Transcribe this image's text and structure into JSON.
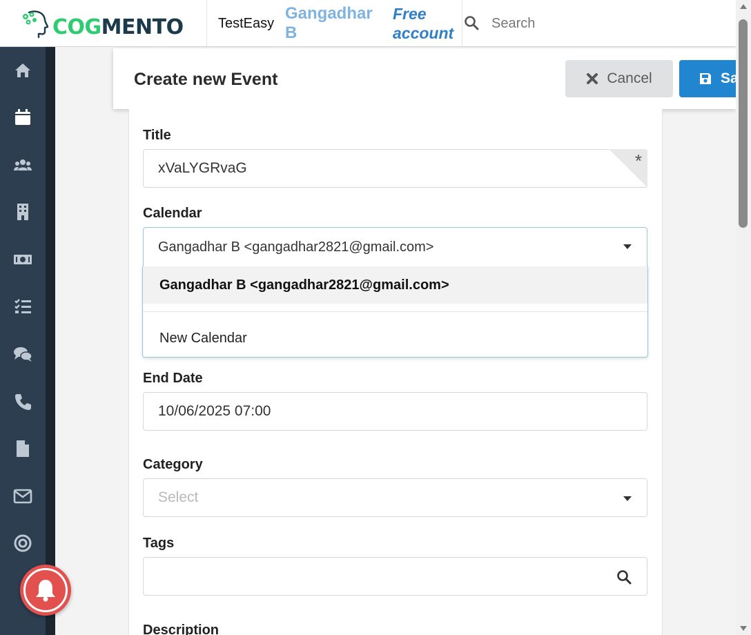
{
  "header": {
    "logo_text_1": "COG",
    "logo_text_2": "MENTO",
    "company": "TestEasy",
    "user_name": "Gangadhar B",
    "plan": "Free account",
    "search_placeholder": "Search"
  },
  "sidebar": {
    "items": [
      {
        "icon": "home-icon"
      },
      {
        "icon": "calendar-icon"
      },
      {
        "icon": "contacts-icon"
      },
      {
        "icon": "companies-icon"
      },
      {
        "icon": "deals-icon"
      },
      {
        "icon": "tasks-icon"
      },
      {
        "icon": "cases-icon"
      },
      {
        "icon": "calls-icon"
      },
      {
        "icon": "documents-icon"
      },
      {
        "icon": "email-icon"
      },
      {
        "icon": "campaigns-icon"
      }
    ]
  },
  "page": {
    "title": "Create new Event",
    "cancel_label": "Cancel",
    "save_label": "Save"
  },
  "form": {
    "title_label": "Title",
    "title_value": "xVaLYGRvaG",
    "required_marker": "*",
    "calendar_label": "Calendar",
    "calendar_value": "Gangadhar B <gangadhar2821@gmail.com>",
    "calendar_options": [
      "Gangadhar B <gangadhar2821@gmail.com>",
      "New Calendar"
    ],
    "end_date_label": "End Date",
    "end_date_value": "10/06/2025 07:00",
    "category_label": "Category",
    "category_placeholder": "Select",
    "tags_label": "Tags",
    "description_label": "Description"
  },
  "colors": {
    "sidebar_bg": "#2c3e50",
    "save_button": "#2185d0",
    "cancel_button": "#e0e1e2",
    "bell": "#e2514e",
    "logo_green": "#2ecc71",
    "logo_navy": "#1b3a4b"
  }
}
